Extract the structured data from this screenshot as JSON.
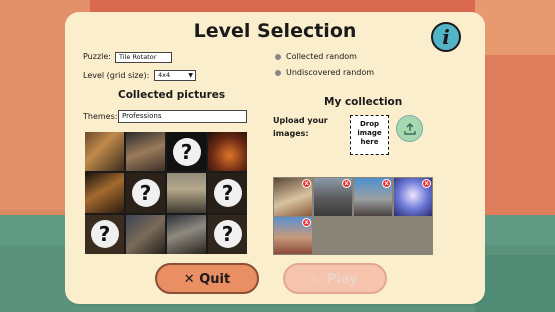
{
  "title": "Level Selection",
  "info_icon": "i",
  "puzzle": {
    "label": "Puzzle:",
    "value": "Tile Rotator"
  },
  "level": {
    "label": "Level (grid size):",
    "value": "4x4"
  },
  "legend": {
    "collected": "Collected random",
    "undiscovered": "Undiscovered random"
  },
  "collected_pictures": {
    "heading": "Collected pictures",
    "themes_label": "Themes:",
    "themes_value": "Professions",
    "unknown_mark": "?"
  },
  "my_collection": {
    "heading": "My collection",
    "upload_label_1": "Upload your",
    "upload_label_2": "images:",
    "drop_line1": "Drop",
    "drop_line2": "image",
    "drop_line3": "here",
    "upload_icon": "upload-icon",
    "remove_mark": "x"
  },
  "buttons": {
    "quit": "Quit",
    "quit_icon": "✕",
    "play": "Play",
    "play_icon": "▷"
  },
  "colors": {
    "panel": "#fbeecd",
    "quit": "#e98f63",
    "play_disabled": "#f6c3ad",
    "info": "#53b4c8"
  }
}
